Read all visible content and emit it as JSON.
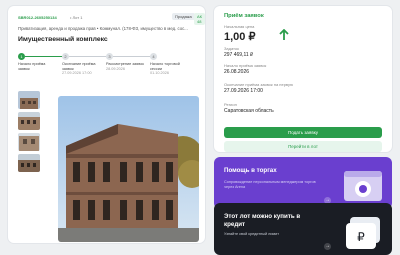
{
  "lot": {
    "number": "SBR012-2605250134",
    "sub": "• Лот 1",
    "sale_badge": "Продажа",
    "status_badge": "АК 48",
    "description": "Приватизация, аренда и продажа прав • Коммунал. (178-ФЗ, имущество в мед. сос...",
    "title": "Имущественный комплекс"
  },
  "steps": [
    {
      "num": "1",
      "label": "Начало приёма заявок",
      "date": ""
    },
    {
      "num": "2",
      "label": "Окончание приёма заявок",
      "date": "27.09.2026 17:00"
    },
    {
      "num": "3",
      "label": "Рассмотрение заявок",
      "date": "28.09.2026"
    },
    {
      "num": "4",
      "label": "Начало торговой сессии",
      "date": "01.10.2026"
    }
  ],
  "sidebar": {
    "title": "Приём заявок",
    "start_price_label": "Начальная цена",
    "start_price": "1,00 ₽",
    "deposit_label": "Задаток",
    "deposit": "297 469,11 ₽",
    "start_label": "Начало приёма заявок",
    "start_date": "26.08.2026",
    "end_label": "Окончание приёма заявок на первую",
    "end_date": "27.09.2026 17:00",
    "region_label": "Регион",
    "region": "Саратовская область",
    "submit": "Подать заявку",
    "goto": "Перейти в лот"
  },
  "promos": [
    {
      "title": "Помощь в торгах",
      "text": "Сопровождение персональным менеджером торгов через Arena",
      "btn": "→"
    },
    {
      "title": "Этот лот можно купить в кредит",
      "text": "Узнайте свой кредитный лимит",
      "btn": "→"
    }
  ],
  "colors": {
    "accent": "#2a9d4b",
    "promo1": "#6a3fcf",
    "promo2": "#1a1d24"
  }
}
